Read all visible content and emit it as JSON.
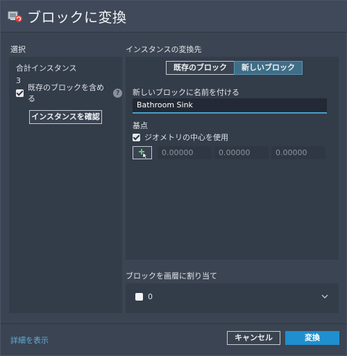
{
  "window": {
    "title": "ブロックに変換",
    "icon": "convert-to-block-icon"
  },
  "selection": {
    "section_label": "選択",
    "total_label": "合計インスタンス",
    "total_count": "3",
    "include_existing_label": "既存のブロックを含める",
    "include_existing_checked": true,
    "help_icon": "question-icon",
    "help_glyph": "?",
    "confirm_button": "インスタンスを確認"
  },
  "conversion": {
    "section_label": "インスタンスの変換先",
    "tabs": [
      {
        "label": "既存のブロック",
        "active": false
      },
      {
        "label": "新しいブロック",
        "active": true
      }
    ],
    "name_label": "新しいブロックに名前を付ける",
    "name_value": "Bathroom Sink",
    "base_point_label": "基点",
    "use_geometry_center_label": "ジオメトリの中心を使用",
    "use_geometry_center_checked": true,
    "pick_point_icon": "pick-point-icon",
    "coords": {
      "x": "0.00000",
      "y": "0.00000",
      "z": "0.00000"
    }
  },
  "layer": {
    "section_label": "ブロックを画層に割り当て",
    "selected_layer": "0",
    "layer_color": "#ffffff"
  },
  "footer": {
    "details_link": "詳細を表示",
    "cancel_button": "キャンセル",
    "convert_button": "変換"
  },
  "colors": {
    "accent": "#1f8fd0",
    "link": "#5cb0dc",
    "active_tab": "#3f6e87"
  }
}
